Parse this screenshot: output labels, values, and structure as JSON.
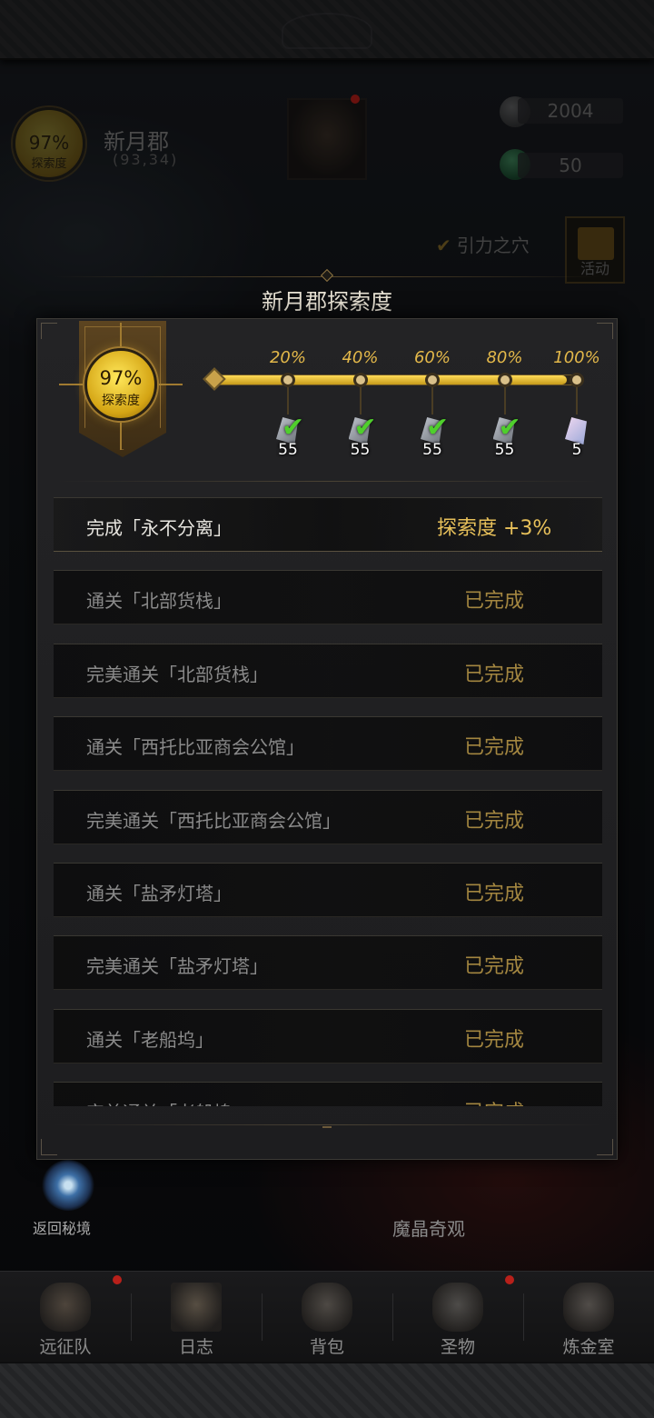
{
  "region": {
    "name": "新月郡",
    "coords": "(93,34)",
    "medal_percent": "97%",
    "medal_label": "探索度"
  },
  "resources": [
    {
      "icon": "ore-icon",
      "value": "2004"
    },
    {
      "icon": "emerald-icon",
      "value": "50"
    }
  ],
  "quest_tag": "引力之穴",
  "gift_button": {
    "label": "活动",
    "icon": "gift-icon"
  },
  "modal": {
    "title": "新月郡探索度",
    "medal_percent": "97%",
    "medal_label": "探索度",
    "progress": 0.97,
    "milestones": [
      {
        "label": "20%",
        "reward_count": "55",
        "claimed": true,
        "reward_icon": "ore-icon"
      },
      {
        "label": "40%",
        "reward_count": "55",
        "claimed": true,
        "reward_icon": "ore-icon"
      },
      {
        "label": "60%",
        "reward_count": "55",
        "claimed": true,
        "reward_icon": "ore-icon"
      },
      {
        "label": "80%",
        "reward_count": "55",
        "claimed": true,
        "reward_icon": "ore-icon"
      },
      {
        "label": "100%",
        "reward_count": "5",
        "claimed": false,
        "reward_icon": "crystal-icon"
      }
    ],
    "tasks": [
      {
        "label": "完成「永不分离」",
        "status": "探索度 +3%",
        "active": true
      },
      {
        "label": "通关「北部货栈」",
        "status": "已完成",
        "active": false
      },
      {
        "label": "完美通关「北部货栈」",
        "status": "已完成",
        "active": false
      },
      {
        "label": "通关「西托比亚商会公馆」",
        "status": "已完成",
        "active": false
      },
      {
        "label": "完美通关「西托比亚商会公馆」",
        "status": "已完成",
        "active": false
      },
      {
        "label": "通关「盐矛灯塔」",
        "status": "已完成",
        "active": false
      },
      {
        "label": "完美通关「盐矛灯塔」",
        "status": "已完成",
        "active": false
      },
      {
        "label": "通关「老船坞」",
        "status": "已完成",
        "active": false
      },
      {
        "label": "完美通关「老船坞」",
        "status": "已完成",
        "active": false
      }
    ]
  },
  "portal_button": {
    "label": "返回秘境",
    "icon": "portal-icon"
  },
  "wonder_label": "魔晶奇观",
  "nav": [
    {
      "label": "远征队",
      "icon": "helmet-icon",
      "has_dot": true
    },
    {
      "label": "日志",
      "icon": "map-scroll-icon",
      "has_dot": false
    },
    {
      "label": "背包",
      "icon": "backpack-icon",
      "has_dot": false
    },
    {
      "label": "圣物",
      "icon": "relic-icon",
      "has_dot": true
    },
    {
      "label": "炼金室",
      "icon": "alchemy-icon",
      "has_dot": false
    }
  ],
  "colors": {
    "gold": "#e7c05a",
    "status_done": "#a38640",
    "check_green": "#4fcf2c",
    "notify_red": "#b8201a"
  }
}
